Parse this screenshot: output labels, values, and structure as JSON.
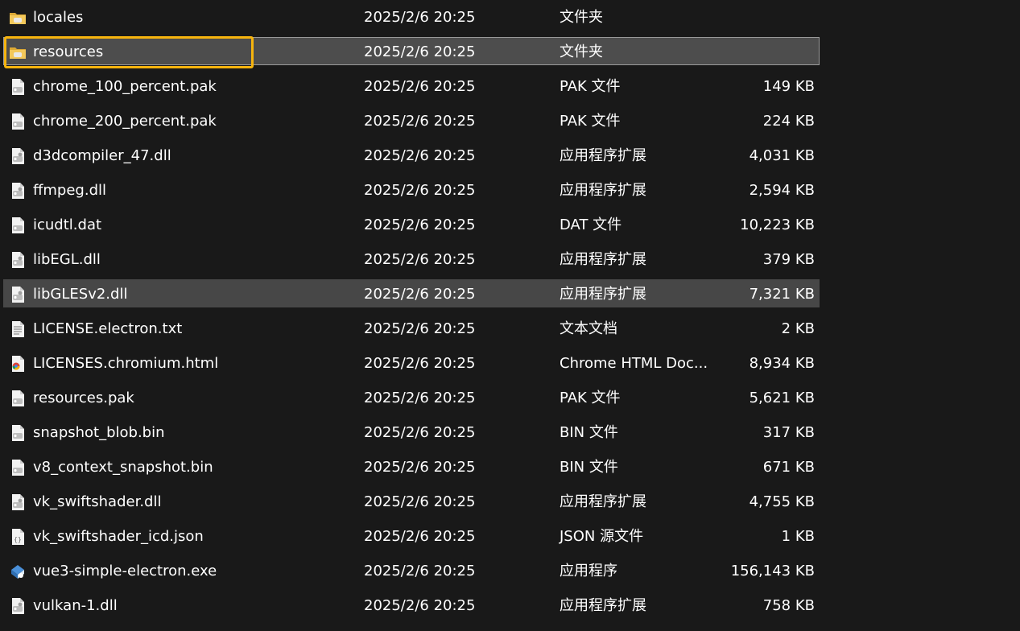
{
  "files": [
    {
      "name": "locales",
      "date": "2025/2/6 20:25",
      "type": "文件夹",
      "size": "",
      "icon": "folder-icon",
      "state": ""
    },
    {
      "name": "resources",
      "date": "2025/2/6 20:25",
      "type": "文件夹",
      "size": "",
      "icon": "folder-icon",
      "state": "selected"
    },
    {
      "name": "chrome_100_percent.pak",
      "date": "2025/2/6 20:25",
      "type": "PAK 文件",
      "size": "149 KB",
      "icon": "generic-file-icon",
      "state": ""
    },
    {
      "name": "chrome_200_percent.pak",
      "date": "2025/2/6 20:25",
      "type": "PAK 文件",
      "size": "224 KB",
      "icon": "generic-file-icon",
      "state": ""
    },
    {
      "name": "d3dcompiler_47.dll",
      "date": "2025/2/6 20:25",
      "type": "应用程序扩展",
      "size": "4,031 KB",
      "icon": "dll-file-icon",
      "state": ""
    },
    {
      "name": "ffmpeg.dll",
      "date": "2025/2/6 20:25",
      "type": "应用程序扩展",
      "size": "2,594 KB",
      "icon": "dll-file-icon",
      "state": ""
    },
    {
      "name": "icudtl.dat",
      "date": "2025/2/6 20:25",
      "type": "DAT 文件",
      "size": "10,223 KB",
      "icon": "generic-file-icon",
      "state": ""
    },
    {
      "name": "libEGL.dll",
      "date": "2025/2/6 20:25",
      "type": "应用程序扩展",
      "size": "379 KB",
      "icon": "dll-file-icon",
      "state": ""
    },
    {
      "name": "libGLESv2.dll",
      "date": "2025/2/6 20:25",
      "type": "应用程序扩展",
      "size": "7,321 KB",
      "icon": "dll-file-icon",
      "state": "hover"
    },
    {
      "name": "LICENSE.electron.txt",
      "date": "2025/2/6 20:25",
      "type": "文本文档",
      "size": "2 KB",
      "icon": "text-file-icon",
      "state": ""
    },
    {
      "name": "LICENSES.chromium.html",
      "date": "2025/2/6 20:25",
      "type": "Chrome HTML Doc...",
      "size": "8,934 KB",
      "icon": "chrome-html-file-icon",
      "state": ""
    },
    {
      "name": "resources.pak",
      "date": "2025/2/6 20:25",
      "type": "PAK 文件",
      "size": "5,621 KB",
      "icon": "generic-file-icon",
      "state": ""
    },
    {
      "name": "snapshot_blob.bin",
      "date": "2025/2/6 20:25",
      "type": "BIN 文件",
      "size": "317 KB",
      "icon": "generic-file-icon",
      "state": ""
    },
    {
      "name": "v8_context_snapshot.bin",
      "date": "2025/2/6 20:25",
      "type": "BIN 文件",
      "size": "671 KB",
      "icon": "generic-file-icon",
      "state": ""
    },
    {
      "name": "vk_swiftshader.dll",
      "date": "2025/2/6 20:25",
      "type": "应用程序扩展",
      "size": "4,755 KB",
      "icon": "dll-file-icon",
      "state": ""
    },
    {
      "name": "vk_swiftshader_icd.json",
      "date": "2025/2/6 20:25",
      "type": "JSON 源文件",
      "size": "1 KB",
      "icon": "json-file-icon",
      "state": ""
    },
    {
      "name": "vue3-simple-electron.exe",
      "date": "2025/2/6 20:25",
      "type": "应用程序",
      "size": "156,143 KB",
      "icon": "electron-app-icon",
      "state": ""
    },
    {
      "name": "vulkan-1.dll",
      "date": "2025/2/6 20:25",
      "type": "应用程序扩展",
      "size": "758 KB",
      "icon": "dll-file-icon",
      "state": ""
    }
  ],
  "colors": {
    "background": "#191919",
    "selection": "#4d4d4d",
    "focus_ring": "#f6b40e",
    "text": "#ffffff"
  }
}
